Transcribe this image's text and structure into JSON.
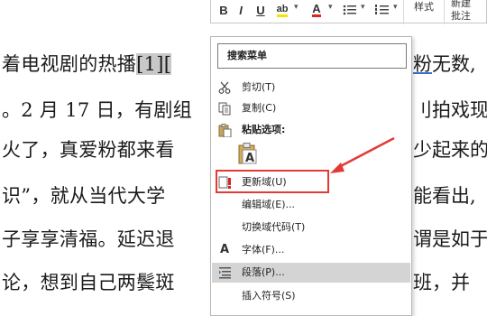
{
  "document": {
    "lines": [
      {
        "pre": "着电视剧的热播",
        "sel": "[1][",
        "post": ""
      },
      {
        "pre": "。2 月 17 日，有剧组",
        "sel": "",
        "post": ""
      },
      {
        "pre": "火了，真爱粉都来看",
        "sel": "",
        "post": ""
      },
      {
        "pre": "识”，就从当代大学",
        "sel": "",
        "post": ""
      },
      {
        "pre": "子享享清福。延迟退",
        "sel": "",
        "post": ""
      },
      {
        "pre": "论，想到自己两鬓斑",
        "sel": "",
        "post": ""
      }
    ],
    "right": [
      {
        "text": "粉无数,",
        "underline": "粉"
      },
      {
        "text": "刂拍戏现",
        "underline": ""
      },
      {
        "text": "少起来的",
        "underline": ""
      },
      {
        "text": "能看出,",
        "underline": ""
      },
      {
        "text": "谓是如于",
        "underline": ""
      },
      {
        "text": "班，并",
        "underline": ""
      }
    ]
  },
  "toolbar": {
    "bold": "B",
    "italic": "I",
    "underline": "U",
    "highlight": "ab",
    "font_color": "A",
    "styles_label": "样式",
    "new_comment_label_1": "新建",
    "new_comment_label_2": "批注"
  },
  "menu": {
    "search_placeholder": "搜索菜单",
    "items": [
      {
        "label": "剪切(T)",
        "icon": "scissors-icon"
      },
      {
        "label": "复制(C)",
        "icon": "copy-icon"
      },
      {
        "label": "粘贴选项:",
        "icon": "paste-icon"
      },
      {
        "label": "更新域(U)",
        "icon": "update-field-icon"
      },
      {
        "label": "编辑域(E)...",
        "icon": ""
      },
      {
        "label": "切换域代码(T)",
        "icon": ""
      },
      {
        "label": "字体(F)...",
        "icon": "font-icon"
      },
      {
        "label": "段落(P)...",
        "icon": "paragraph-icon"
      },
      {
        "label": "插入符号(S)",
        "icon": ""
      }
    ]
  },
  "colors": {
    "highlight_box": "#e23b36",
    "arrow": "#e23b36",
    "selection": "#c8c8c8"
  }
}
